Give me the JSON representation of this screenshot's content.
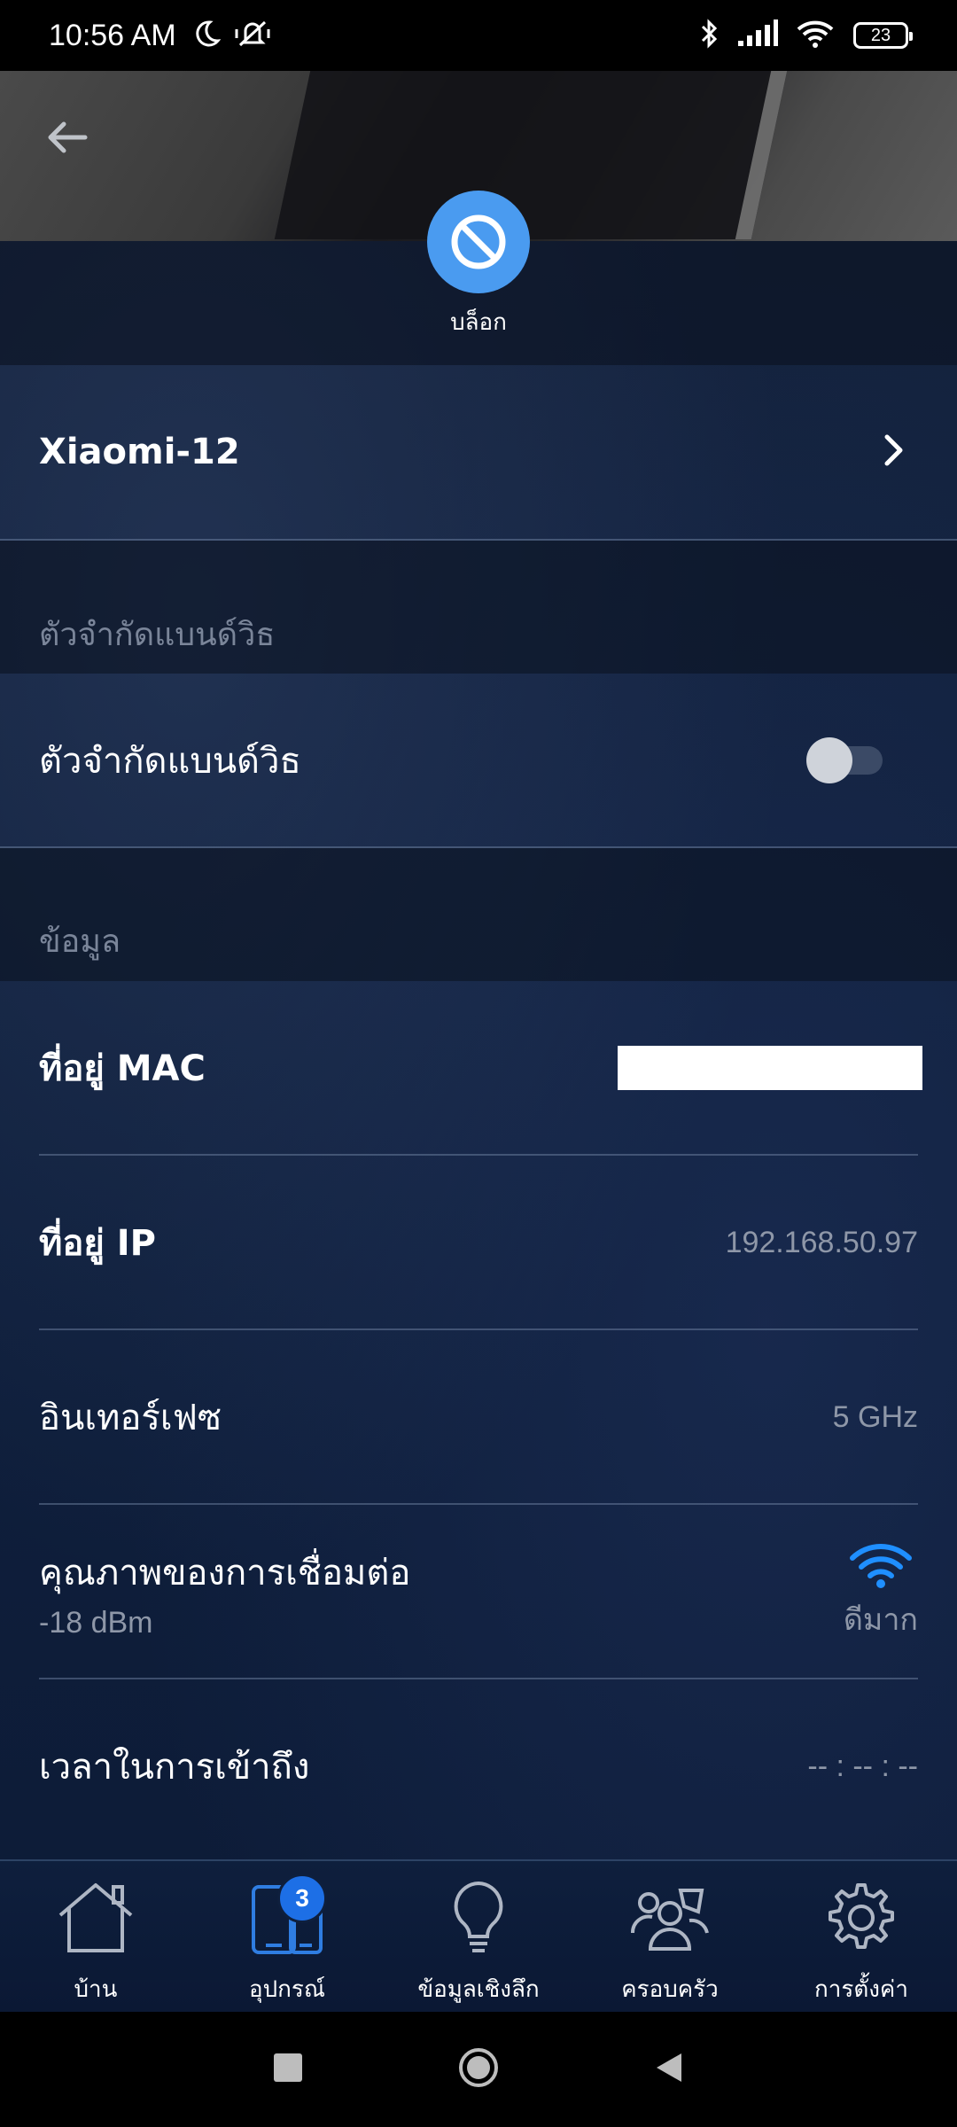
{
  "status_bar": {
    "time": "10:56 AM",
    "battery": "23",
    "icons": [
      "moon-icon",
      "mute-vibrate-icon",
      "bluetooth-icon",
      "signal-icon",
      "wifi-icon",
      "battery-icon"
    ]
  },
  "header": {
    "back_icon": "arrow-left-icon",
    "block_action": {
      "label": "บล็อก",
      "icon": "block-icon",
      "color": "#4a9bf0"
    }
  },
  "device": {
    "name": "Xiaomi-12"
  },
  "bandwidth_section": {
    "header": "ตัวจำกัดแบนด์วิธ",
    "toggle_label": "ตัวจำกัดแบนด์วิธ",
    "toggle_on": false
  },
  "info_section": {
    "header": "ข้อมูล",
    "mac": {
      "label": "ที่อยู่ MAC"
    },
    "ip": {
      "label": "ที่อยู่ IP",
      "value": "192.168.50.97"
    },
    "interface": {
      "label": "อินเทอร์เฟซ",
      "value": "5 GHz"
    },
    "quality": {
      "label": "คุณภาพของการเชื่อมต่อ",
      "sub": "-18 dBm",
      "status": "ดีมาก",
      "icon_color": "#1f8fff"
    },
    "access_time": {
      "label": "เวลาในการเข้าถึง",
      "value": "-- : -- : --"
    }
  },
  "bottom_nav": {
    "items": [
      {
        "label": "บ้าน",
        "icon": "home-icon"
      },
      {
        "label": "อุปกรณ์",
        "icon": "devices-icon",
        "badge": "3",
        "active": true
      },
      {
        "label": "ข้อมูลเชิงลึก",
        "icon": "lightbulb-icon"
      },
      {
        "label": "ครอบครัว",
        "icon": "family-icon"
      },
      {
        "label": "การตั้งค่า",
        "icon": "gear-icon"
      }
    ]
  },
  "system_nav": [
    "recents-icon",
    "home-circle-icon",
    "back-triangle-icon"
  ]
}
